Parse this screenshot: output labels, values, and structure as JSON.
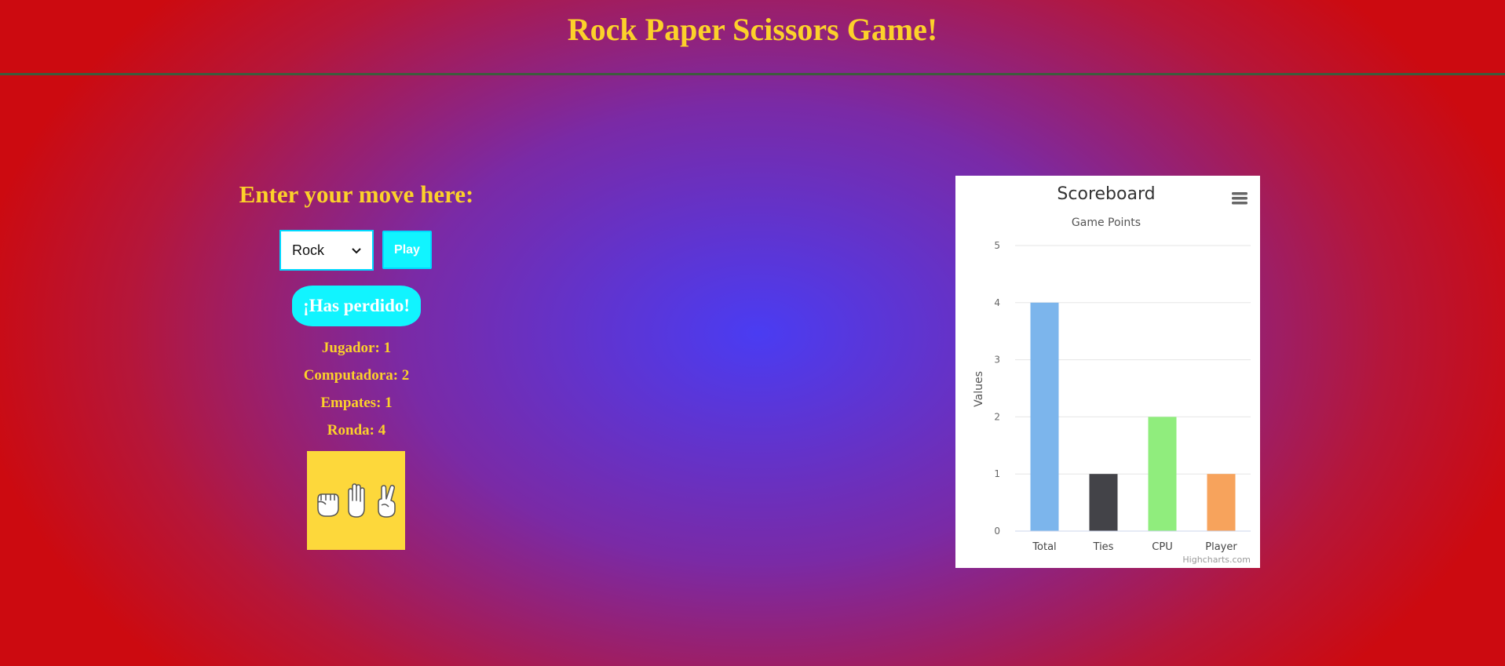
{
  "header": {
    "title": "Rock Paper Scissors Game!"
  },
  "game": {
    "prompt": "Enter your move here:",
    "select_value": "Rock",
    "play_label": "Play",
    "result": "¡Has perdido!",
    "stats": {
      "player": "Jugador: 1",
      "computer": "Computadora: 2",
      "ties": "Empates: 1",
      "round": "Ronda: 4"
    },
    "image_icons": [
      "rock-hand-icon",
      "paper-hand-icon",
      "scissors-hand-icon"
    ]
  },
  "chart_menu_icon": "hamburger-menu-icon",
  "chart_data": {
    "type": "bar",
    "title": "Scoreboard",
    "subtitle": "Game Points",
    "ylabel": "Values",
    "xlabel": "",
    "categories": [
      "Total",
      "Ties",
      "CPU",
      "Player"
    ],
    "values": [
      4,
      1,
      2,
      1
    ],
    "colors": [
      "#7cb5ec",
      "#434348",
      "#90ed7d",
      "#f7a35c"
    ],
    "ylim": [
      0,
      5
    ],
    "yticks": [
      "0",
      "1",
      "2",
      "3",
      "4",
      "5"
    ],
    "grid": true,
    "legend": "none",
    "credits": "Highcharts.com"
  }
}
